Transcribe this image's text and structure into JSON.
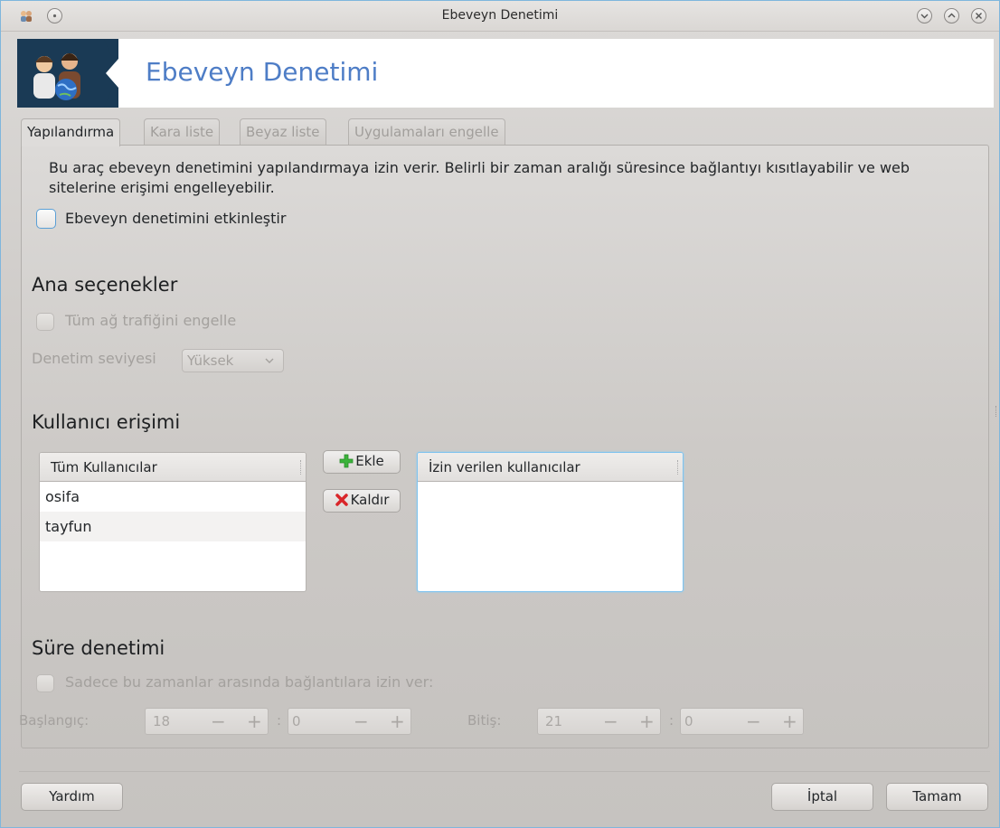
{
  "window": {
    "title": "Ebeveyn Denetimi",
    "controls": [
      "minimize",
      "maximize",
      "close"
    ]
  },
  "banner": {
    "title": "Ebeveyn Denetimi",
    "icon": "parents-globe-icon"
  },
  "tabs": [
    {
      "label": "Yapılandırma",
      "active": true
    },
    {
      "label": "Kara liste",
      "active": false
    },
    {
      "label": "Beyaz liste",
      "active": false
    },
    {
      "label": "Uygulamaları engelle",
      "active": false
    }
  ],
  "config": {
    "description": "Bu araç ebeveyn denetimini yapılandırmaya izin verir. Belirli bir zaman aralığı süresince bağlantıyı kısıtlayabilir ve web sitelerine erişimi engelleyebilir.",
    "enable_label": "Ebeveyn denetimini etkinleştir",
    "enable_checked": false
  },
  "main_options": {
    "title": "Ana seçenekler",
    "block_all_label": "Tüm ağ trafiğini engelle",
    "level_label": "Denetim seviyesi",
    "level_value": "Yüksek"
  },
  "user_access": {
    "title": "Kullanıcı erişimi",
    "all_users_header": "Tüm Kullanıcılar",
    "all_users": [
      "osifa",
      "tayfun"
    ],
    "add_label": "Ekle",
    "remove_label": "Kaldır",
    "allowed_header": "İzin verilen kullanıcılar",
    "allowed_users": []
  },
  "time_control": {
    "title": "Süre denetimi",
    "only_between_label": "Sadece bu zamanlar arasında bağlantılara izin ver:",
    "start_label": "Başlangıç:",
    "start_hour": "18",
    "start_minute": "0",
    "end_label": "Bitiş:",
    "end_hour": "21",
    "end_minute": "0",
    "colon": ":",
    "minus": "−",
    "plus": "+"
  },
  "footer": {
    "help_label": "Yardım",
    "cancel_label": "İptal",
    "ok_label": "Tamam"
  },
  "colors": {
    "banner_title": "#4e7dc6",
    "focus_border": "#7ec2ee",
    "add_icon": "#3bb33b",
    "remove_icon": "#d9262a"
  }
}
